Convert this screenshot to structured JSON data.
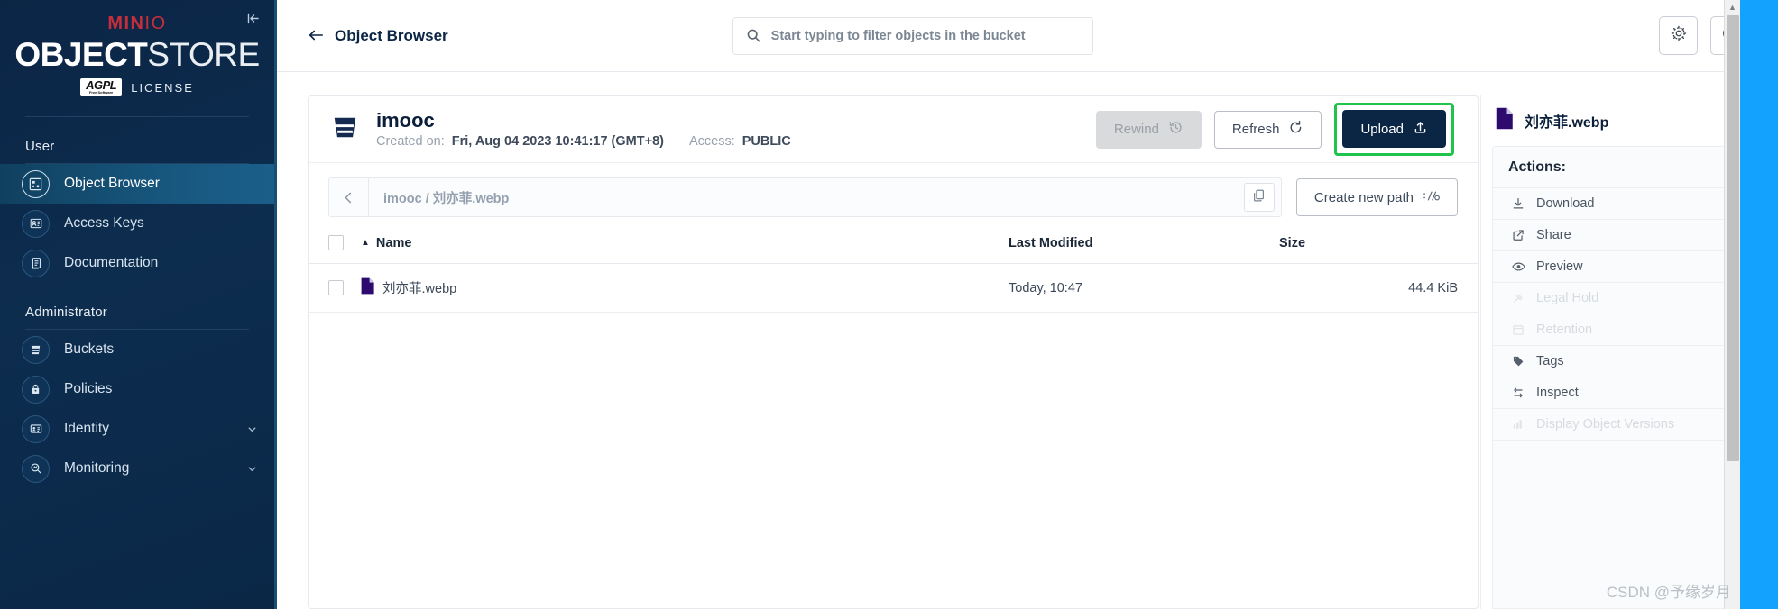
{
  "sidebar": {
    "logo": {
      "brand_prefix": "MIN",
      "brand_suffix": "IO",
      "product_bold": "OBJECT",
      "product_light": "STORE",
      "license_badge": "AGPL",
      "license_badge_sub": "Free Software",
      "license_text": "LICENSE"
    },
    "collapse_icon": "collapse-panel-icon",
    "sections": [
      {
        "label": "User",
        "items": [
          {
            "label": "Object Browser",
            "icon": "object-browser-icon",
            "active": true,
            "expandable": false
          },
          {
            "label": "Access Keys",
            "icon": "access-keys-icon",
            "active": false,
            "expandable": false
          },
          {
            "label": "Documentation",
            "icon": "documentation-icon",
            "active": false,
            "expandable": false
          }
        ]
      },
      {
        "label": "Administrator",
        "items": [
          {
            "label": "Buckets",
            "icon": "bucket-icon",
            "active": false,
            "expandable": false
          },
          {
            "label": "Policies",
            "icon": "policy-lock-icon",
            "active": false,
            "expandable": false
          },
          {
            "label": "Identity",
            "icon": "identity-card-icon",
            "active": false,
            "expandable": true
          },
          {
            "label": "Monitoring",
            "icon": "monitoring-magnifier-icon",
            "active": false,
            "expandable": true
          }
        ]
      }
    ]
  },
  "topbar": {
    "back_icon": "back-arrow-icon",
    "title": "Object Browser",
    "search": {
      "icon": "search-icon",
      "placeholder": "Start typing to filter objects in the bucket",
      "value": ""
    },
    "settings_button": {
      "icon": "gear-icon",
      "label": "Settings"
    },
    "help_button": {
      "icon": "help-circle-icon",
      "label": "Help"
    }
  },
  "bucket": {
    "icon": "bucket-icon",
    "name": "imooc",
    "created_label": "Created on:",
    "created_value": "Fri, Aug 04 2023 10:41:17 (GMT+8)",
    "access_label": "Access:",
    "access_value": "PUBLIC",
    "actions": {
      "rewind": {
        "label": "Rewind",
        "icon": "rewind-clock-icon",
        "disabled": true
      },
      "refresh": {
        "label": "Refresh",
        "icon": "refresh-icon",
        "disabled": false
      },
      "upload": {
        "label": "Upload",
        "icon": "upload-icon",
        "disabled": false,
        "highlight_color": "#21c44a"
      }
    }
  },
  "path_bar": {
    "back_icon": "chevron-left-icon",
    "breadcrumb": "imooc / 刘亦菲.webp",
    "copy_icon": "copy-icon",
    "create_path_button": {
      "label": "Create new path",
      "icon": "new-path-icon"
    }
  },
  "objects_table": {
    "select_all_checkbox": "",
    "columns": [
      {
        "key": "name",
        "label": "Name",
        "sorted": true,
        "sort_icon": "sort-ascending-caret"
      },
      {
        "key": "last_modified",
        "label": "Last Modified"
      },
      {
        "key": "size",
        "label": "Size"
      }
    ],
    "rows": [
      {
        "selected": false,
        "icon": "file-webp-icon",
        "name": "刘亦菲.webp",
        "last_modified": "Today, 10:47",
        "size": "44.4 KiB"
      }
    ]
  },
  "details_panel": {
    "file_icon": "file-webp-icon",
    "file_name": "刘亦菲.webp",
    "expand_icon": "expand-panel-icon",
    "actions_title": "Actions:",
    "actions": [
      {
        "label": "Download",
        "icon": "download-icon",
        "disabled": false
      },
      {
        "label": "Share",
        "icon": "share-icon",
        "disabled": false
      },
      {
        "label": "Preview",
        "icon": "eye-icon",
        "disabled": false
      },
      {
        "label": "Legal Hold",
        "icon": "legal-hold-icon",
        "disabled": true
      },
      {
        "label": "Retention",
        "icon": "retention-calendar-icon",
        "disabled": true
      },
      {
        "label": "Tags",
        "icon": "tag-icon",
        "disabled": false
      },
      {
        "label": "Inspect",
        "icon": "inspect-icon",
        "disabled": false
      },
      {
        "label": "Display Object Versions",
        "icon": "versions-bars-icon",
        "disabled": true
      }
    ]
  },
  "browser_chrome": {
    "scrollbar": {
      "up_arrow_icon": "scroll-up-arrow-icon"
    }
  },
  "watermark": {
    "text": "CSDN @予缘岁月"
  },
  "colors": {
    "sidebar_bg": "#0b2545",
    "sidebar_active": "#17577e",
    "brand_red": "#c72e3b",
    "primary_dark": "#0b2545",
    "highlight_green": "#21c44a",
    "right_strip_blue": "#13a3ff"
  }
}
